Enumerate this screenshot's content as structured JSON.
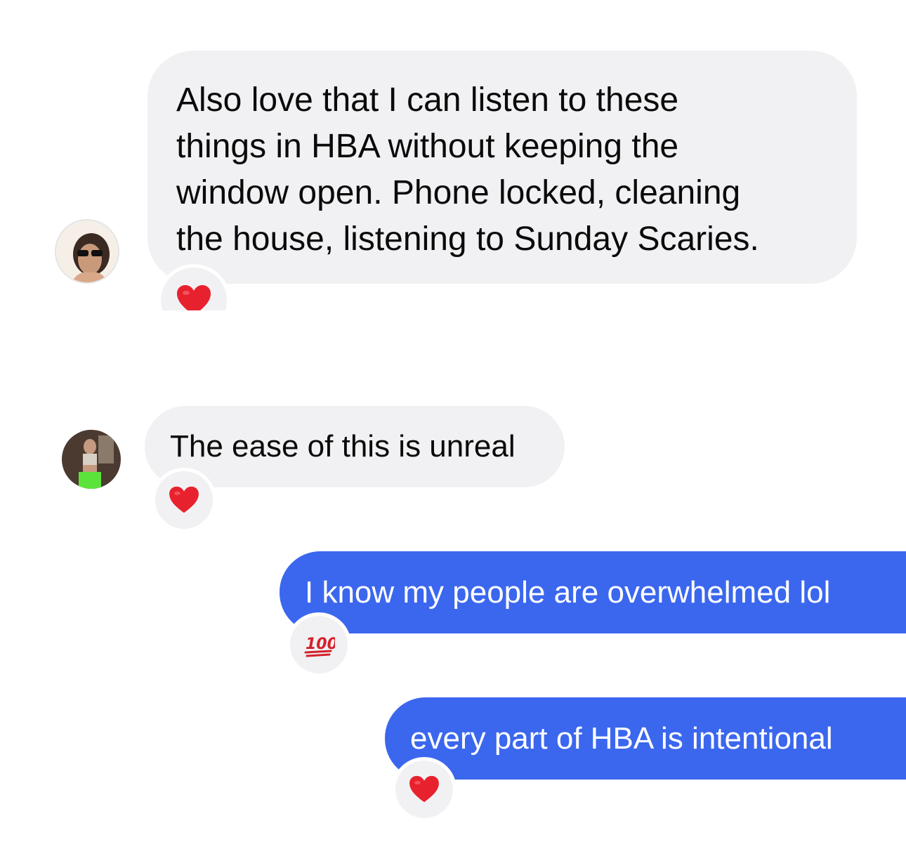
{
  "conversation": {
    "messages": [
      {
        "sender": "incoming",
        "lines": [
          "Also love that I can listen to these",
          "things in HBA without keeping the",
          "window open. Phone locked, cleaning",
          "the house, listening to Sunday Scaries."
        ],
        "reaction": "red-heart-icon"
      },
      {
        "sender": "incoming",
        "text": "The ease of this is unreal",
        "reaction": "red-heart-icon"
      },
      {
        "sender": "outgoing",
        "text": "I know my people are overwhelmed lol",
        "reaction": "hundred-points-icon",
        "reaction_text": "100"
      },
      {
        "sender": "outgoing",
        "text": "every part of HBA is intentional",
        "reaction": "red-heart-icon"
      }
    ]
  },
  "colors": {
    "incoming_bubble": "#f1f1f3",
    "outgoing_bubble": "#3b67ee",
    "heart": "#e8212e",
    "hundred": "#d4202a"
  }
}
